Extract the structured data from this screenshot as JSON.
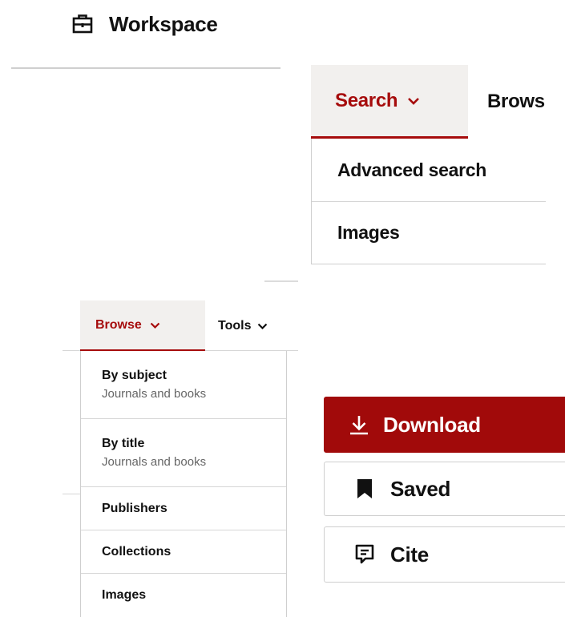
{
  "workspace": {
    "icon": "briefcase-icon",
    "title": "Workspace"
  },
  "search_nav": {
    "active_tab": {
      "label": "Search",
      "icon": "chevron-down-icon"
    },
    "next_tab": {
      "label": "Brows"
    },
    "menu_items": [
      {
        "label": "Advanced search"
      },
      {
        "label": "Images"
      }
    ]
  },
  "browse_nav": {
    "active_tab": {
      "label": "Browse",
      "icon": "chevron-down-icon"
    },
    "tools_tab": {
      "label": "Tools",
      "icon": "chevron-down-icon"
    },
    "menu_items": [
      {
        "label": "By subject",
        "sub": "Journals and books"
      },
      {
        "label": "By title",
        "sub": "Journals and books"
      },
      {
        "label": "Publishers"
      },
      {
        "label": "Collections"
      },
      {
        "label": "Images"
      }
    ]
  },
  "actions": {
    "download": {
      "label": "Download",
      "icon": "download-icon"
    },
    "saved": {
      "label": "Saved",
      "icon": "bookmark-icon"
    },
    "cite": {
      "label": "Cite",
      "icon": "cite-icon"
    }
  },
  "colors": {
    "accent": "#a60c0c",
    "download_bg": "#a10a0a",
    "active_tab_bg": "#f2f0ee",
    "divider": "#cfcfcf",
    "subtext": "#666666"
  }
}
